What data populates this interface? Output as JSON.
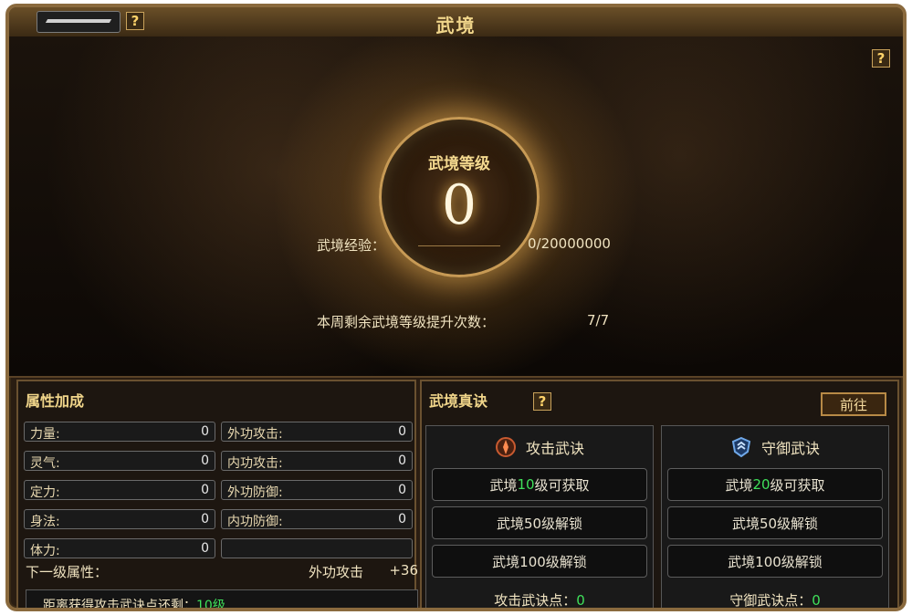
{
  "window": {
    "title": "武境"
  },
  "scene": {
    "level_label": "武境等级",
    "level_value": "0",
    "exp_label": "武境经验：",
    "exp_value": "0/20000000",
    "weekly_label": "本周剩余武境等级提升次数：",
    "weekly_value": "7/7"
  },
  "attributes": {
    "title": "属性加成",
    "items": [
      {
        "label": "力量:",
        "value": "0"
      },
      {
        "label": "外功攻击:",
        "value": "0"
      },
      {
        "label": "灵气:",
        "value": "0"
      },
      {
        "label": "内功攻击:",
        "value": "0"
      },
      {
        "label": "定力:",
        "value": "0"
      },
      {
        "label": "外功防御:",
        "value": "0"
      },
      {
        "label": "身法:",
        "value": "0"
      },
      {
        "label": "内功防御:",
        "value": "0"
      },
      {
        "label": "体力:",
        "value": "0"
      },
      {
        "label": "",
        "value": ""
      }
    ],
    "next_label": "下一级属性：",
    "next_attr": "外功攻击",
    "next_value": "+36",
    "unlock_prefix": "距离获得攻击武诀点还剩：",
    "unlock_value": "10级"
  },
  "secrets": {
    "title": "武境真诀",
    "goto_label": "前往",
    "attack": {
      "title": "攻击武诀",
      "slot1_prefix": "武境",
      "slot1_level": "10",
      "slot1_suffix": "级可获取",
      "slot2": "武境50级解锁",
      "slot3": "武境100级解锁",
      "points_label": "攻击武诀点：",
      "points_value": "0"
    },
    "defense": {
      "title": "守御武诀",
      "slot1_prefix": "武境",
      "slot1_level": "20",
      "slot1_suffix": "级可获取",
      "slot2": "武境50级解锁",
      "slot3": "武境100级解锁",
      "points_label": "守御武诀点：",
      "points_value": "0"
    }
  },
  "colors": {
    "accent_gold": "#f0d58a",
    "green": "#3fe05a",
    "border": "#6a5130"
  },
  "icons": [
    "help-icon",
    "attack-emblem-icon",
    "defense-emblem-icon"
  ]
}
